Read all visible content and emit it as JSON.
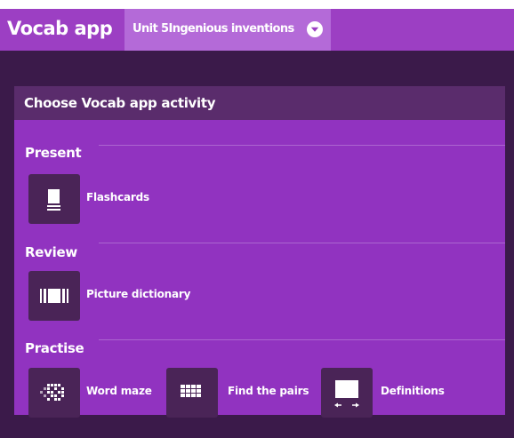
{
  "header": {
    "app_title": "Vocab app",
    "unit_selected": "Unit 5Ingenious inventions"
  },
  "panel": {
    "title": "Choose Vocab app activity",
    "sections": [
      {
        "title": "Present",
        "activities": [
          {
            "label": "Flashcards",
            "icon": "flashcards-icon"
          }
        ]
      },
      {
        "title": "Review",
        "activities": [
          {
            "label": "Picture dictionary",
            "icon": "picture-dictionary-icon"
          }
        ]
      },
      {
        "title": "Practise",
        "activities": [
          {
            "label": "Word maze",
            "icon": "word-maze-icon"
          },
          {
            "label": "Find the pairs",
            "icon": "find-pairs-icon"
          },
          {
            "label": "Definitions",
            "icon": "definitions-icon"
          }
        ]
      }
    ]
  },
  "colors": {
    "topbar": "#9c3fc3",
    "unit_select_bg": "#b46ad8",
    "dark_band": "#3b1a4a",
    "panel_bg": "#9133c0",
    "panel_header": "#5a2c6c",
    "tile_bg": "#4a2457"
  }
}
